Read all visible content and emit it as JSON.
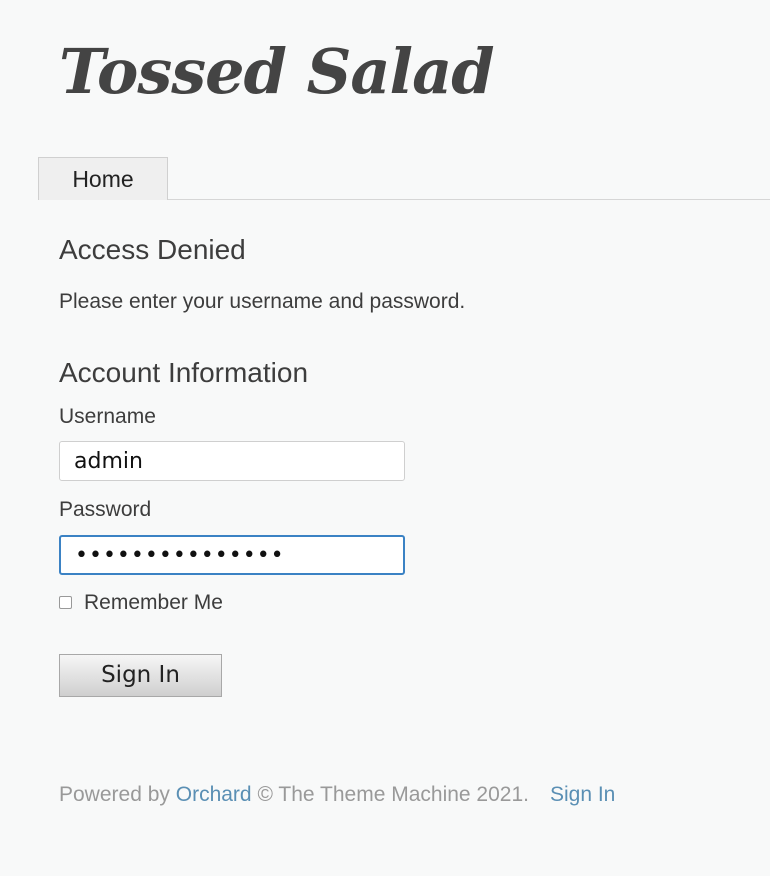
{
  "header": {
    "site_title": "Tossed Salad"
  },
  "nav": {
    "tabs": [
      {
        "label": "Home"
      }
    ]
  },
  "main": {
    "access_heading": "Access Denied",
    "access_message": "Please enter your username and password.",
    "account_heading": "Account Information",
    "username_label": "Username",
    "username_value": "admin",
    "password_label": "Password",
    "password_value": "•••••••••••••••",
    "remember_label": "Remember Me",
    "remember_checked": false,
    "signin_button": "Sign In"
  },
  "footer": {
    "powered_by": "Powered by",
    "orchard_link": "Orchard",
    "copyright": "© The Theme Machine 2021.",
    "signin_link": "Sign In"
  },
  "colors": {
    "link": "#5a8fb4",
    "focus_border": "#3b82c4",
    "page_background": "#f8f9f9"
  }
}
